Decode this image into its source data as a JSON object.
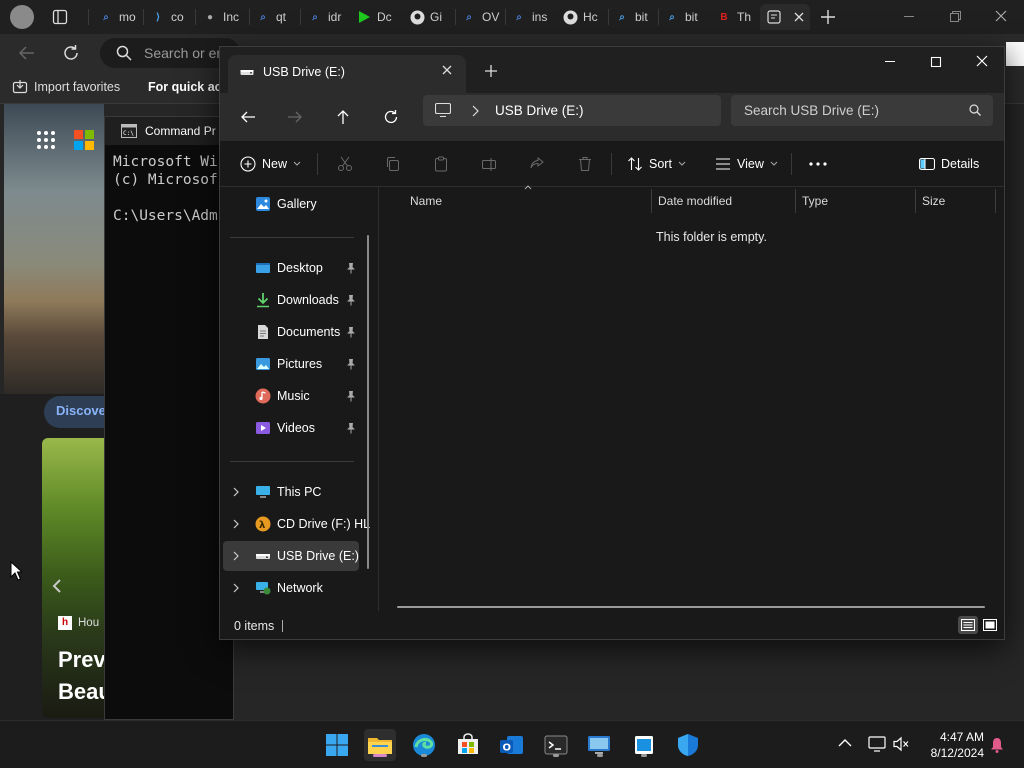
{
  "edge": {
    "tabs": [
      "mo",
      "co",
      "Inc",
      "qt",
      "idr",
      "Dc",
      "Gi",
      "OV",
      "ins",
      "Hc",
      "bit",
      "bit",
      "Th"
    ],
    "address_placeholder": "Search or en",
    "favorites": {
      "import": "Import favorites",
      "quick": "For quick acc"
    },
    "discover": "Discove",
    "news_source": "Hou",
    "news_headline_1": "Prev",
    "news_headline_2": "Beau"
  },
  "cmd": {
    "title": "Command Pr",
    "lines": [
      "Microsoft Wi",
      "(c) Microsof",
      "",
      "C:\\Users\\Adm"
    ]
  },
  "explorer": {
    "tab_title": "USB Drive (E:)",
    "breadcrumb": "USB Drive (E:)",
    "search_placeholder": "Search USB Drive (E:)",
    "commands": {
      "new": "New",
      "sort": "Sort",
      "view": "View",
      "details": "Details"
    },
    "sidebar": {
      "top": [
        {
          "label": "Gallery",
          "icon": "gallery-icon"
        }
      ],
      "quick": [
        {
          "label": "Desktop",
          "icon": "desktop-icon"
        },
        {
          "label": "Downloads",
          "icon": "downloads-icon"
        },
        {
          "label": "Documents",
          "icon": "documents-icon"
        },
        {
          "label": "Pictures",
          "icon": "pictures-icon"
        },
        {
          "label": "Music",
          "icon": "music-icon"
        },
        {
          "label": "Videos",
          "icon": "videos-icon"
        }
      ],
      "drives": [
        {
          "label": "This PC",
          "icon": "this-pc-icon"
        },
        {
          "label": "CD Drive (F:) HL",
          "icon": "cd-drive-icon"
        },
        {
          "label": "USB Drive (E:)",
          "icon": "usb-drive-icon",
          "selected": true
        },
        {
          "label": "Network",
          "icon": "network-icon"
        }
      ]
    },
    "columns": [
      "Name",
      "Date modified",
      "Type",
      "Size"
    ],
    "empty_message": "This folder is empty.",
    "status": "0 items"
  },
  "taskbar": {
    "icons": [
      "start-icon",
      "file-explorer-icon",
      "edge-icon",
      "store-icon",
      "outlook-icon",
      "terminal-icon",
      "remote-desktop-icon",
      "notepad-icon",
      "defender-icon"
    ],
    "time": "4:47 AM",
    "date": "8/12/2024"
  },
  "colors": {
    "accent": "#60cdff",
    "selection": "#3a3a3a",
    "taskbar_bg": "#1c1c1c"
  }
}
